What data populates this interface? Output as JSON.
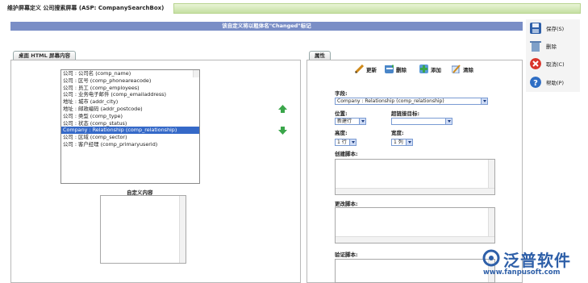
{
  "window": {
    "title": "维护屏幕定义 公司搜索屏幕 (ASP: CompanySearchBox)"
  },
  "notice": "该自定义将以粗体名\"Changed\"标记",
  "left_tab": "桌面 HTML 屏幕内容",
  "fields_list": [
    "公司 : 公司名 (comp_name)",
    "公司 : 区号 (comp_phoneareacode)",
    "公司 : 员工 (comp_employees)",
    "公司 : 业务电子邮件 (comp_emailaddress)",
    "地址 : 城市 (addr_city)",
    "地址 : 邮政编码 (addr_postcode)",
    "公司 : 类型 (comp_type)",
    "公司 : 状态 (comp_status)",
    "Company : Relationship (comp_relationship)",
    "公司 : 区域 (comp_sector)",
    "公司 : 客户经理 (comp_primaryuserid)"
  ],
  "selected_index": 8,
  "custom_content_label": "自定义内容",
  "right_tab": "属性",
  "toolbar": {
    "update": "更新",
    "delete": "删除",
    "add": "添加",
    "clear": "清除"
  },
  "props": {
    "field_label": "字段:",
    "field_value": "Company : Relationship (comp_relationship)",
    "position_label": "位置:",
    "position_value": "新建行",
    "hyperlink_label": "超链接目标:",
    "hyperlink_value": "",
    "height_label": "高度:",
    "height_value": "1 行",
    "width_label": "宽度:",
    "width_value": "1 列",
    "create_script_label": "创建脚本:",
    "change_script_label": "更改脚本:",
    "validate_script_label": "验证脚本:"
  },
  "side": {
    "save": "保存(S)",
    "delete": "删除",
    "cancel": "取消(C)",
    "help": "帮助(P)"
  },
  "logo": {
    "name": "泛普软件",
    "url": "www.fanpusoft.com"
  },
  "colors": {
    "accent": "#7a8ec6",
    "selected": "#3569c8",
    "green_arrow": "#3aa64a"
  }
}
